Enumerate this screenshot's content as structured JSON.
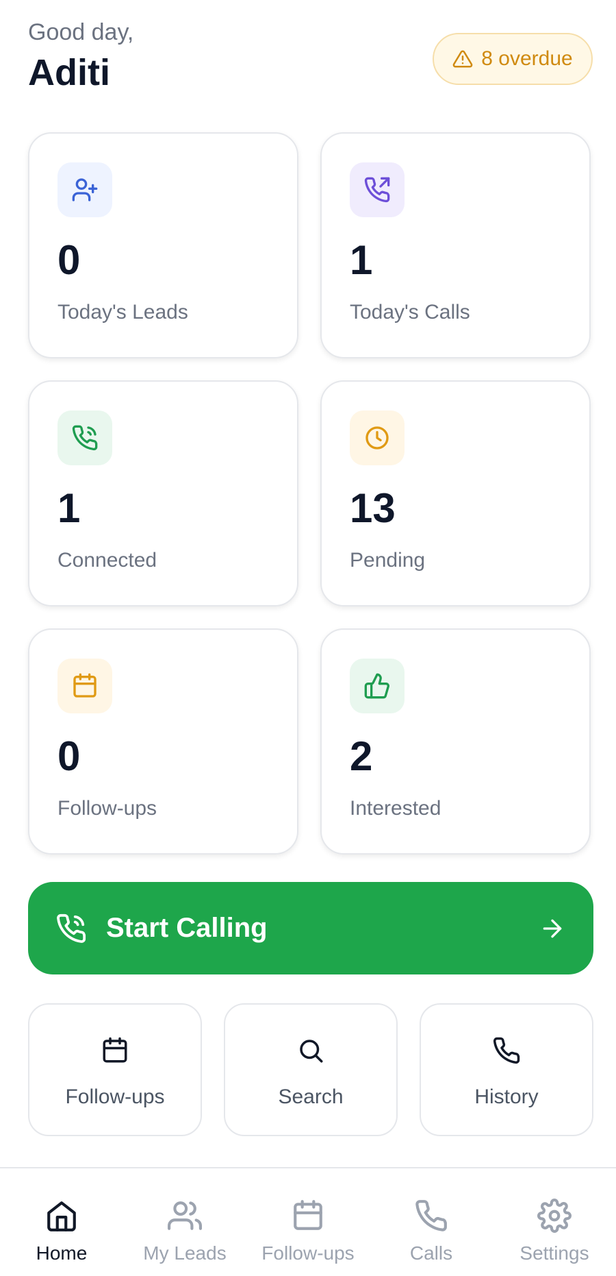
{
  "header": {
    "greeting": "Good day,",
    "user_name": "Aditi",
    "overdue_badge": {
      "icon": "warning-icon",
      "label": "8 overdue"
    }
  },
  "stats": [
    {
      "icon": "user-plus-icon",
      "value": "0",
      "label": "Today's Leads"
    },
    {
      "icon": "phone-outgoing-icon",
      "value": "1",
      "label": "Today's Calls"
    },
    {
      "icon": "phone-connected-icon",
      "value": "1",
      "label": "Connected"
    },
    {
      "icon": "clock-icon",
      "value": "13",
      "label": "Pending"
    },
    {
      "icon": "calendar-icon",
      "value": "0",
      "label": "Follow-ups"
    },
    {
      "icon": "thumbs-up-icon",
      "value": "2",
      "label": "Interested"
    }
  ],
  "start_calling": {
    "icon": "phone-ringing-icon",
    "label": "Start Calling",
    "arrow_icon": "arrow-right-icon"
  },
  "quick_actions": [
    {
      "icon": "calendar-icon",
      "label": "Follow-ups"
    },
    {
      "icon": "search-icon",
      "label": "Search"
    },
    {
      "icon": "phone-icon",
      "label": "History"
    }
  ],
  "bottom_nav": [
    {
      "icon": "home-icon",
      "label": "Home",
      "active": true
    },
    {
      "icon": "users-icon",
      "label": "My Leads",
      "active": false
    },
    {
      "icon": "calendar-icon",
      "label": "Follow-ups",
      "active": false
    },
    {
      "icon": "phone-icon",
      "label": "Calls",
      "active": false
    },
    {
      "icon": "gear-icon",
      "label": "Settings",
      "active": false
    }
  ],
  "colors": {
    "primary_green": "#1ea64b",
    "warning_amber": "#d08a10",
    "text_dark": "#0f172a",
    "text_muted": "#6b7280"
  }
}
